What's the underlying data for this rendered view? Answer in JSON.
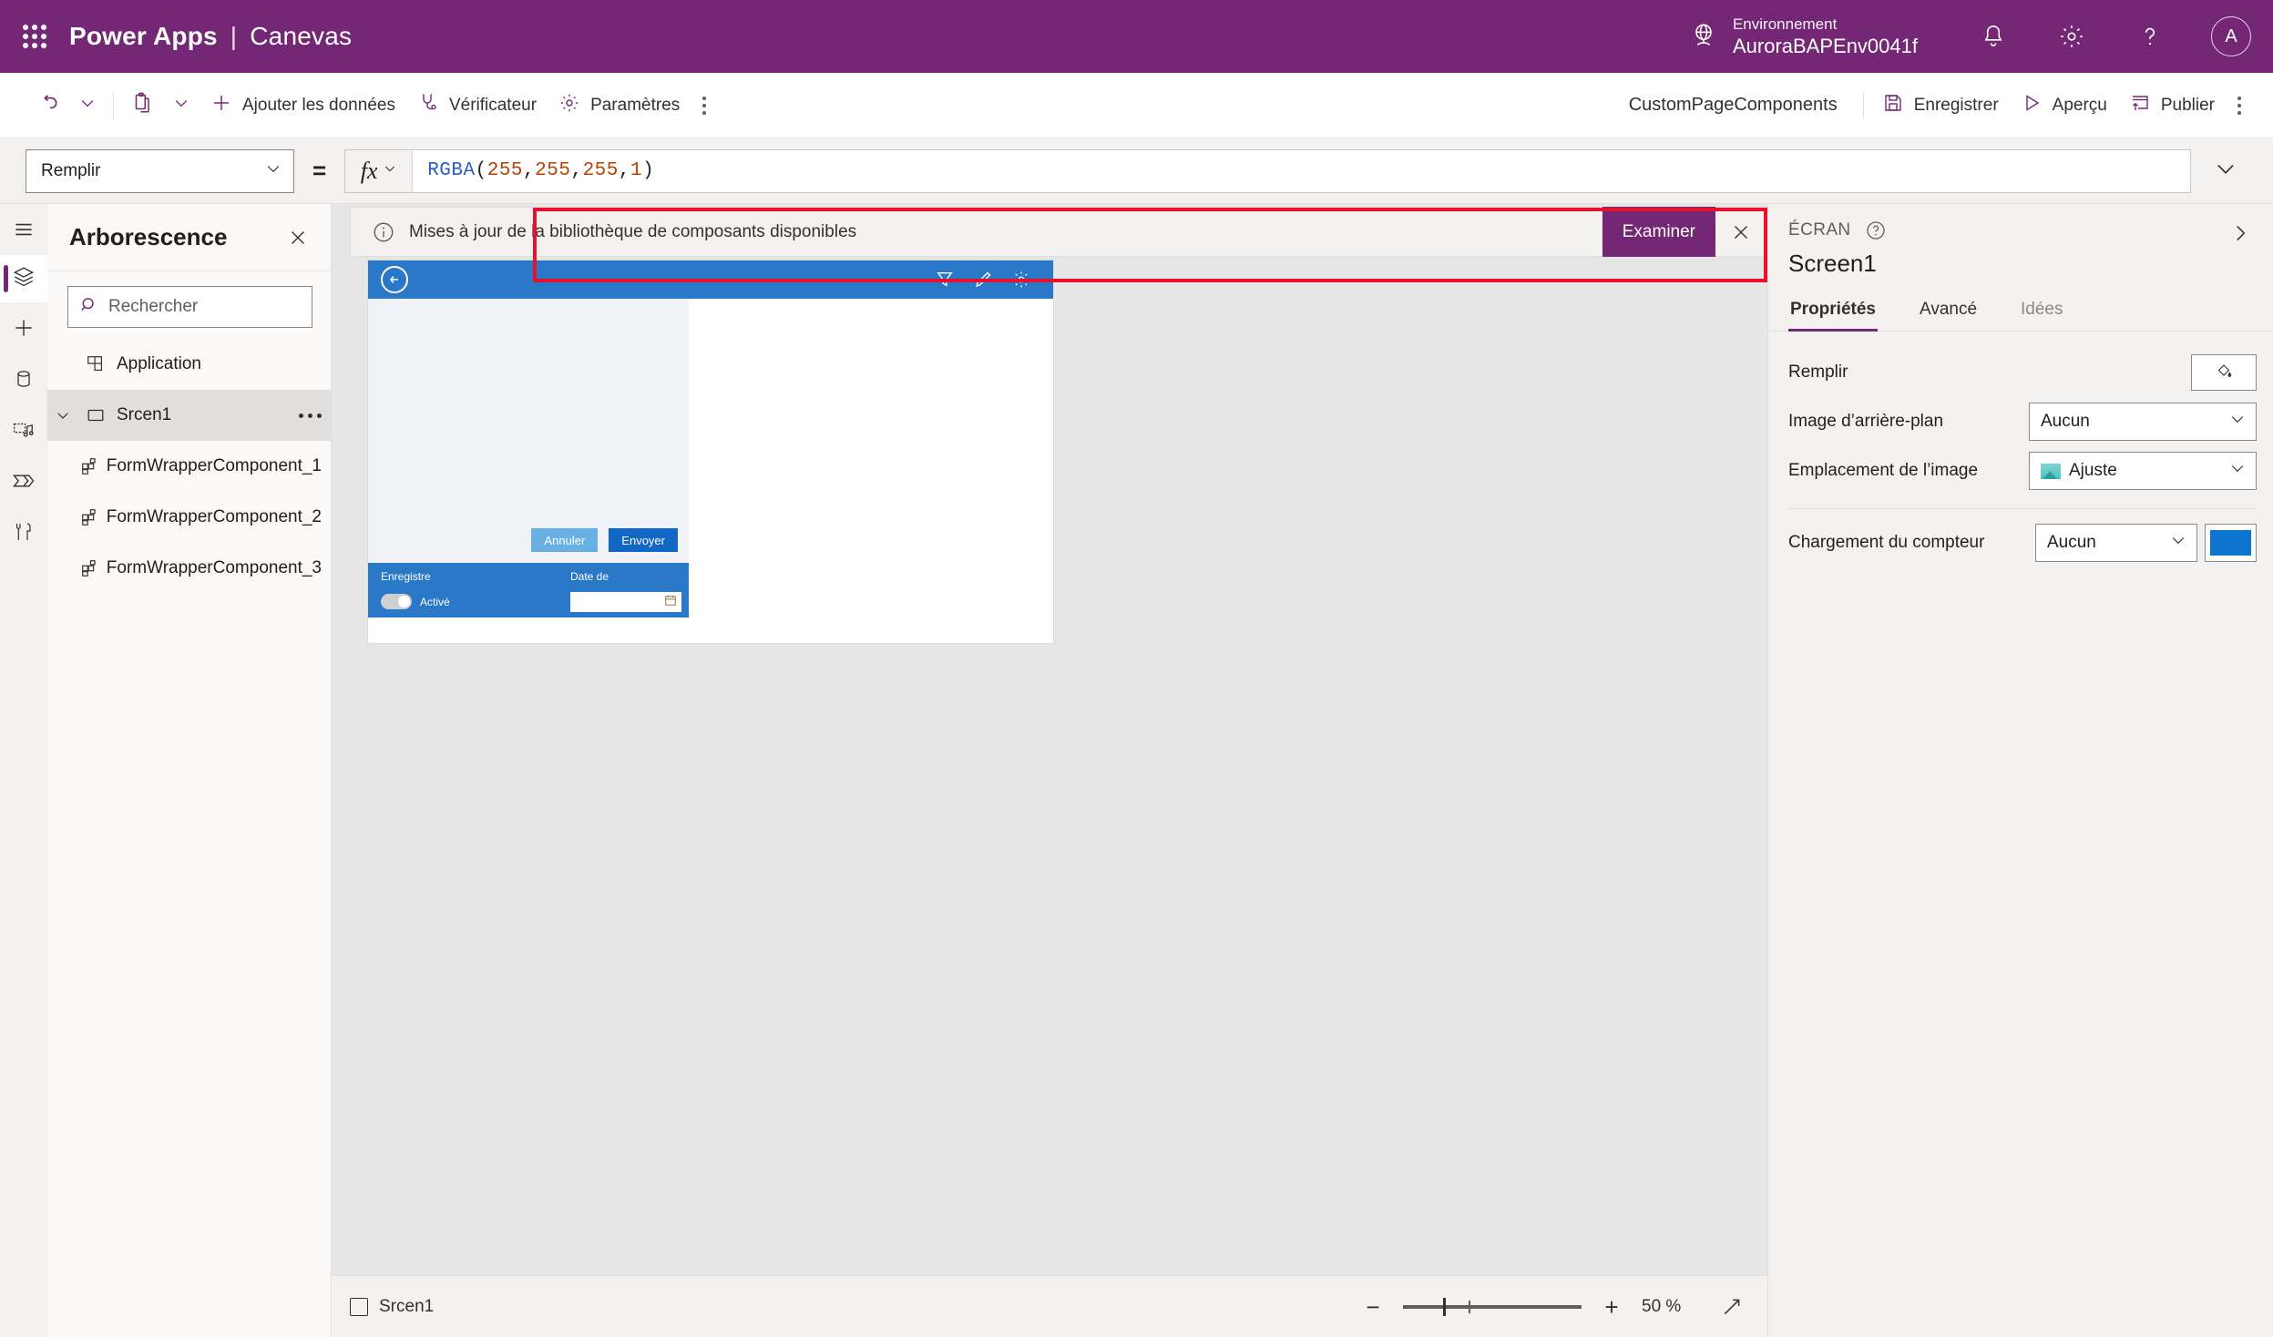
{
  "topbar": {
    "waffle_icon": "app-launcher-icon",
    "brand": "Power Apps",
    "separator": "|",
    "brand_sub": "Canevas",
    "environment_label": "Environnement",
    "environment_name": "AuroraBAPEnv0041f",
    "globe_icon": "globe-icon",
    "notification_icon": "bell-icon",
    "settings_icon": "gear-icon",
    "help_icon": "question-mark-icon",
    "avatar_initial": "A",
    "accent": "#742774"
  },
  "commandbar": {
    "undo_icon": "undo-icon",
    "undo_caret": "chevron-down-icon",
    "paste_icon": "clipboard-icon",
    "paste_caret": "chevron-down-icon",
    "add_data_label": "Ajouter les données",
    "add_data_icon": "plus-icon",
    "checker_label": "Vérificateur",
    "checker_icon": "stethoscope-icon",
    "settings_label": "Paramètres",
    "settings_icon": "gear-icon",
    "overflow_icon": "kebab-menu-icon",
    "app_name": "CustomPageComponents",
    "save_label": "Enregistrer",
    "save_icon": "save-icon",
    "preview_label": "Aperçu",
    "preview_icon": "play-icon",
    "publish_label": "Publier",
    "publish_icon": "publish-icon",
    "right_overflow_icon": "kebab-menu-icon"
  },
  "formulabar": {
    "property": "Remplir",
    "property_caret": "chevron-down-icon",
    "equals": "=",
    "fx_glyph": "fx",
    "fx_caret": "chevron-down-icon",
    "formula_tokens": [
      {
        "text": "RGBA",
        "kind": "fn"
      },
      {
        "text": "(",
        "kind": "punc"
      },
      {
        "text": "255",
        "kind": "num"
      },
      {
        "text": ", ",
        "kind": "punc"
      },
      {
        "text": "255",
        "kind": "num"
      },
      {
        "text": ", ",
        "kind": "punc"
      },
      {
        "text": "255",
        "kind": "num"
      },
      {
        "text": ", ",
        "kind": "punc"
      },
      {
        "text": "1",
        "kind": "num"
      },
      {
        "text": ")",
        "kind": "punc"
      }
    ],
    "formula_text": "RGBA(255, 255, 255, 1)",
    "expand_icon": "chevron-down-icon"
  },
  "rail": {
    "burger_icon": "hamburger-menu-icon",
    "items": [
      {
        "icon": "layers-icon",
        "name": "tree-view",
        "active": true
      },
      {
        "icon": "plus-icon",
        "name": "insert",
        "active": false
      },
      {
        "icon": "database-icon",
        "name": "data",
        "active": false
      },
      {
        "icon": "media-icon",
        "name": "media",
        "active": false
      },
      {
        "icon": "flow-icon",
        "name": "power-automate",
        "active": false
      },
      {
        "icon": "tools-icon",
        "name": "tools",
        "active": false
      }
    ]
  },
  "tree": {
    "title": "Arborescence",
    "close_icon": "close-icon",
    "search_icon": "search-icon",
    "search_placeholder": "Rechercher",
    "search_value": "",
    "items": [
      {
        "label": "Application",
        "icon": "app-icon",
        "indent": 0,
        "selected": false,
        "expandable": false,
        "dots": false
      },
      {
        "label": "Srcen1",
        "icon": "screen-icon",
        "indent": 0,
        "selected": true,
        "expandable": true,
        "dots": true
      },
      {
        "label": "FormWrapperComponent_1",
        "icon": "component-icon",
        "indent": 1,
        "selected": false,
        "expandable": false,
        "dots": false
      },
      {
        "label": "FormWrapperComponent_2",
        "icon": "component-icon",
        "indent": 1,
        "selected": false,
        "expandable": false,
        "dots": false
      },
      {
        "label": "FormWrapperComponent_3",
        "icon": "component-icon",
        "indent": 1,
        "selected": false,
        "expandable": false,
        "dots": false
      }
    ]
  },
  "banner": {
    "info_icon": "info-circle-icon",
    "message": "Mises à jour de la bibliothèque de composants disponibles",
    "action_label": "Examiner",
    "close_icon": "close-icon",
    "highlight_color": "#e8112d"
  },
  "app_preview": {
    "header_bg": "#2a78c8",
    "back_icon": "back-arrow-icon",
    "header_icons": [
      "filter-icon",
      "pencil-icon",
      "gear-icon"
    ],
    "cancel_label": "Annuler",
    "submit_label": "Envoyer",
    "footer_left_label": "Enregistre",
    "toggle_label": "Activé",
    "footer_right_label": "Date de",
    "calendar_icon": "calendar-icon",
    "date_value": ""
  },
  "properties": {
    "kicker": "ÉCRAN",
    "help_icon": "question-circle-icon",
    "collapse_icon": "chevron-right-icon",
    "title": "Screen1",
    "tabs": [
      {
        "label": "Propriétés",
        "active": true
      },
      {
        "label": "Avancé",
        "active": false
      },
      {
        "label": "Idées",
        "active": false,
        "muted": true
      }
    ],
    "rows": [
      {
        "label": "Remplir",
        "control": "fill-button",
        "icon": "paint-bucket-icon"
      },
      {
        "label": "Image d’arrière-plan",
        "control": "dropdown",
        "value": "Aucun"
      },
      {
        "label": "Emplacement de l’image",
        "control": "dropdown",
        "value": "Ajuste",
        "icon": "image-icon"
      },
      {
        "label": "Chargement du compteur",
        "control": "dropdown-swatch",
        "value": "Aucun",
        "swatch": "#0d75ce"
      }
    ]
  },
  "statusbar": {
    "screen_icon": "screen-icon",
    "screen_label": "Srcen1",
    "zoom_out_icon": "minus-icon",
    "zoom_in_icon": "plus-icon",
    "zoom_value": "50 %",
    "fit_icon": "fit-to-screen-icon"
  }
}
